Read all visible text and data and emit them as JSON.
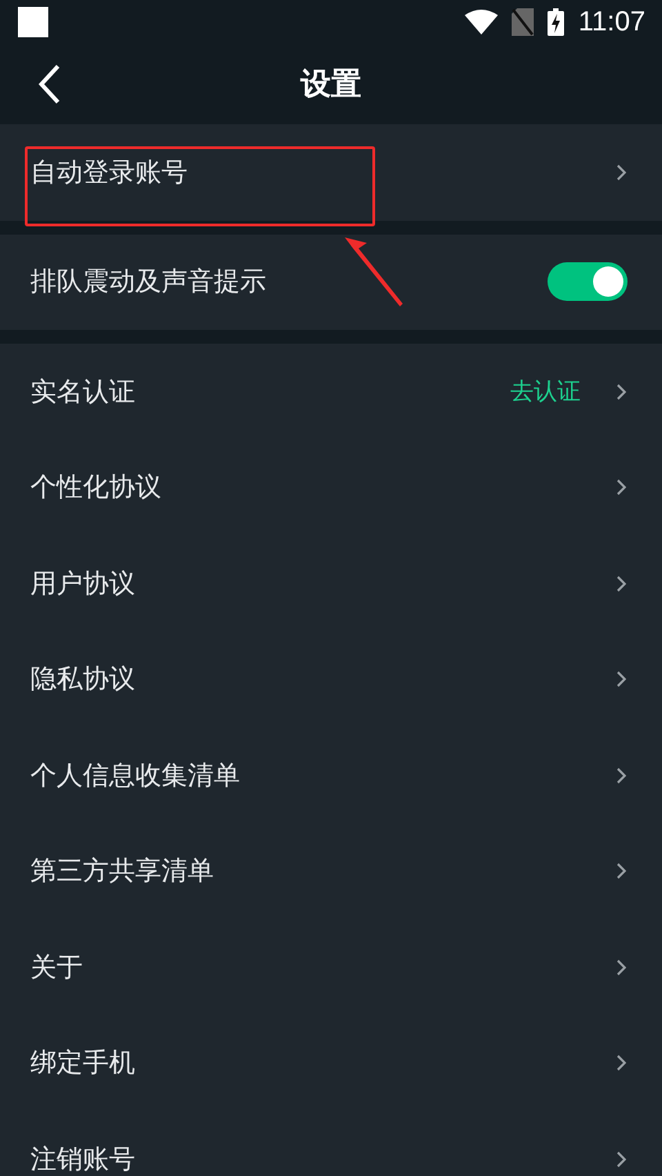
{
  "status_bar": {
    "time": "11:07"
  },
  "header": {
    "title": "设置"
  },
  "groups": [
    {
      "items": [
        {
          "kind": "link",
          "label": "自动登录账号"
        }
      ]
    },
    {
      "items": [
        {
          "kind": "toggle",
          "label": "排队震动及声音提示",
          "on": true
        }
      ]
    },
    {
      "items": [
        {
          "kind": "link",
          "label": "实名认证",
          "value": "去认证"
        },
        {
          "kind": "link",
          "label": "个性化协议"
        },
        {
          "kind": "link",
          "label": "用户协议"
        },
        {
          "kind": "link",
          "label": "隐私协议"
        },
        {
          "kind": "link",
          "label": "个人信息收集清单"
        },
        {
          "kind": "link",
          "label": "第三方共享清单"
        },
        {
          "kind": "link",
          "label": "关于"
        },
        {
          "kind": "link",
          "label": "绑定手机"
        },
        {
          "kind": "link",
          "label": "注销账号"
        }
      ]
    }
  ]
}
